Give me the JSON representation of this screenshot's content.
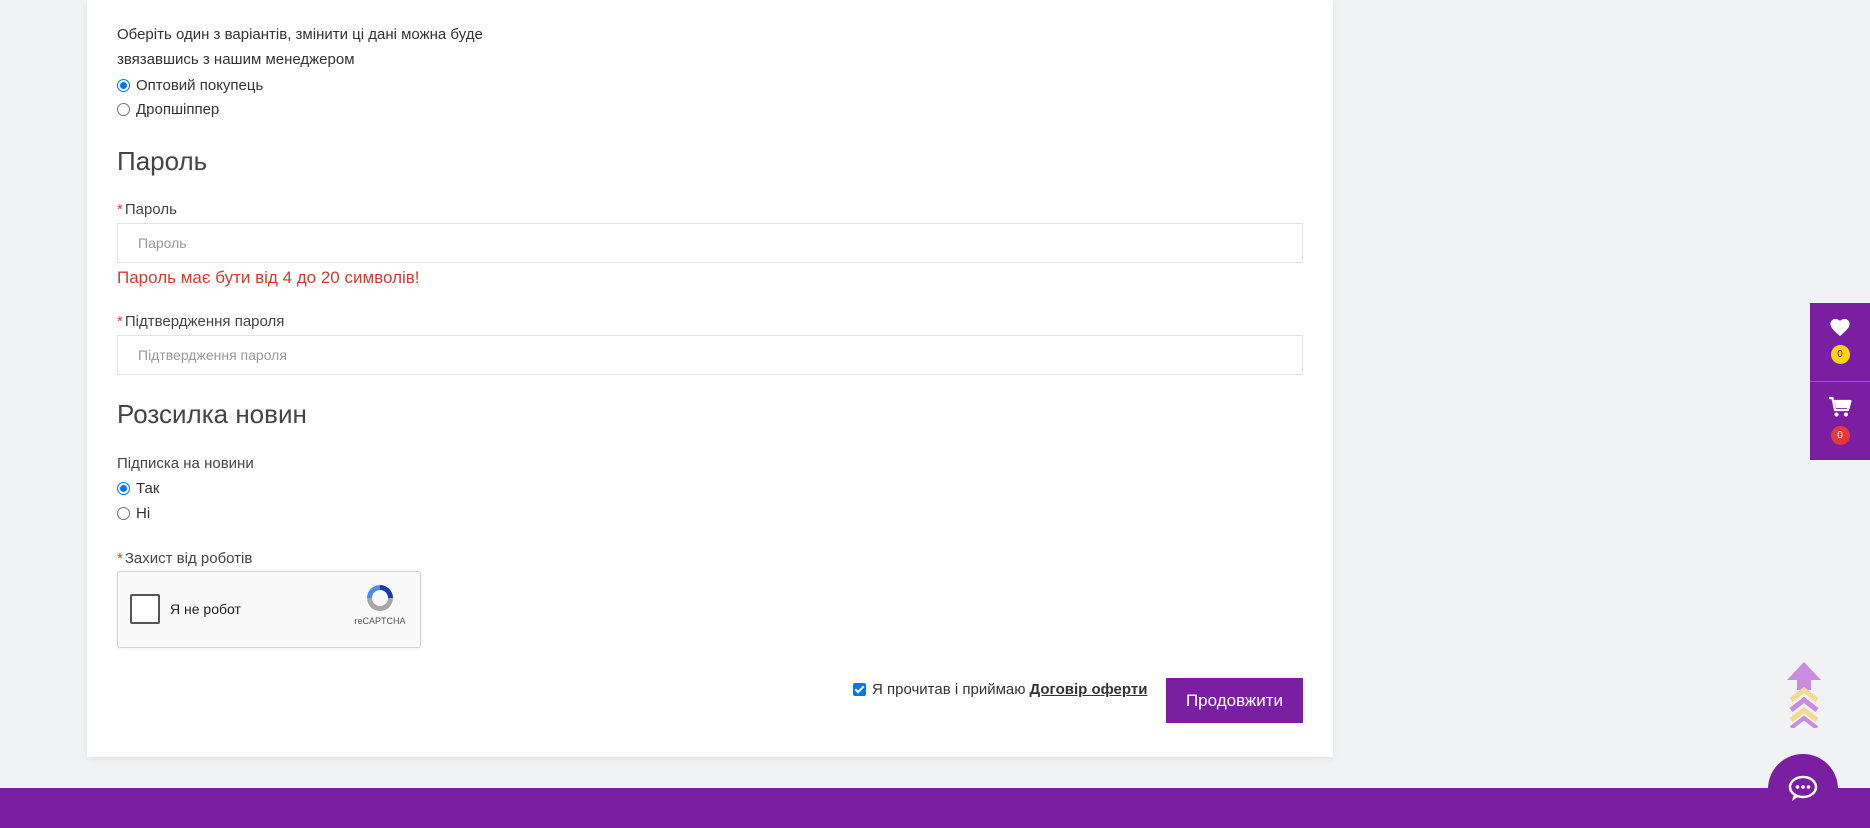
{
  "customer_type": {
    "note": "Оберіть один з варіантів, змінити ці дані можна буде звязавшись з нашим менеджером",
    "options": [
      {
        "label": "Оптовий покупець",
        "checked": true
      },
      {
        "label": "Дропшіппер",
        "checked": false
      }
    ]
  },
  "password_section": {
    "title": "Пароль",
    "password_label": "Пароль",
    "password_placeholder": "Пароль",
    "password_error": "Пароль має бути від 4 до 20 символів!",
    "confirm_label": "Підтвердження пароля",
    "confirm_placeholder": "Підтвердження пароля"
  },
  "newsletter_section": {
    "title": "Розсилка новин",
    "label": "Підписка на новини",
    "options": [
      {
        "label": "Так",
        "checked": true
      },
      {
        "label": "Ні",
        "checked": false
      }
    ]
  },
  "captcha": {
    "label": "Захист від роботів",
    "checkbox_text": "Я не робот",
    "brand": "reCAPTCHA"
  },
  "agreement": {
    "text": "Я прочитав і приймаю",
    "link": "Договір оферти",
    "checked": true
  },
  "continue_button": "Продовжити",
  "side_panel": {
    "wishlist_count": "0",
    "cart_count": "0"
  },
  "colors": {
    "brand": "#7b1fa2",
    "error": "#d23c2f",
    "badge_yellow": "#ffd600",
    "badge_red": "#e53935"
  },
  "icons": [
    "heart-icon",
    "cart-icon",
    "scroll-top-icon",
    "chat-icon",
    "recaptcha-logo-icon"
  ]
}
